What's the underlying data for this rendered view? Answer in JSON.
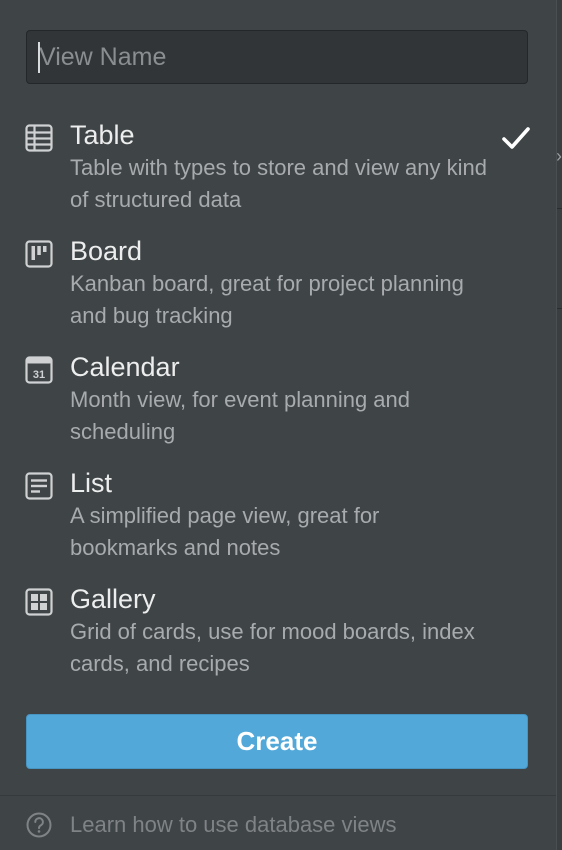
{
  "search": {
    "placeholder": "View Name",
    "value": ""
  },
  "options": [
    {
      "id": "table",
      "title": "Table",
      "description": "Table with types to store and view any kind of structured data",
      "icon": "table-icon",
      "selected": true
    },
    {
      "id": "board",
      "title": "Board",
      "description": "Kanban board, great for project planning and bug tracking",
      "icon": "board-icon",
      "selected": false
    },
    {
      "id": "calendar",
      "title": "Calendar",
      "description": "Month view, for event planning and scheduling",
      "icon": "calendar-icon",
      "icon_text": "31",
      "selected": false
    },
    {
      "id": "list",
      "title": "List",
      "description": "A simplified page view, great for bookmarks and notes",
      "icon": "list-icon",
      "selected": false
    },
    {
      "id": "gallery",
      "title": "Gallery",
      "description": "Grid of cards, use for mood boards, index cards, and recipes",
      "icon": "gallery-icon",
      "selected": false
    }
  ],
  "create_label": "Create",
  "help_text": "Learn how to use database views",
  "colors": {
    "panel": "#3f4447",
    "accent": "#52a8d8",
    "text": "#e8e9ea",
    "muted": "#a8abad"
  }
}
